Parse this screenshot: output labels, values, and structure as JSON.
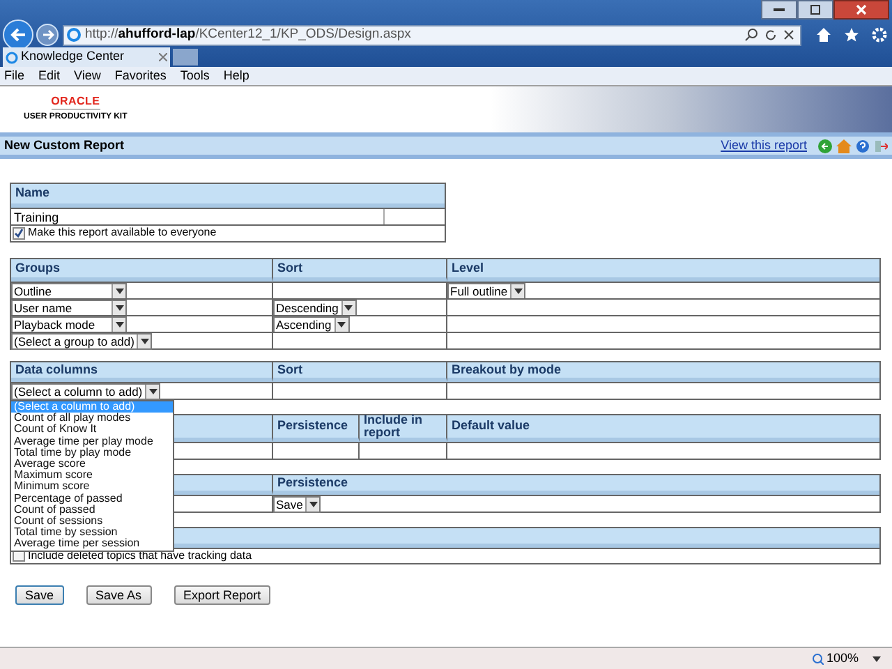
{
  "browser": {
    "url_host": "http://",
    "url_bold": "ahufford-lap",
    "url_path": "/KCenter12_1/KP_ODS/Design.aspx",
    "tab": "Knowledge Center",
    "menu": [
      "File",
      "Edit",
      "View",
      "Favorites",
      "Tools",
      "Help"
    ],
    "zoom": "100%"
  },
  "header": {
    "logo": "ORACLE",
    "product": "USER PRODUCTIVITY KIT"
  },
  "title_bar": {
    "title": "New Custom Report",
    "link": "View this report"
  },
  "name_section": {
    "heading": "Name",
    "value": "Training",
    "share_label": "Make this report available to everyone",
    "share_checked": true
  },
  "groups": {
    "columns": [
      "Groups",
      "Sort",
      "Level"
    ],
    "rows": [
      {
        "group": "Outline",
        "level": "Full outline"
      },
      {
        "group": "User name",
        "sort": "Descending"
      },
      {
        "group": "Playback mode",
        "sort": "Ascending"
      },
      {
        "group": "(Select a group to add)"
      }
    ]
  },
  "data_columns": {
    "columns": [
      "Data columns",
      "Sort",
      "Breakout by mode"
    ],
    "select": "(Select a column to add)",
    "options": [
      {
        "label": "(Select a column to add)",
        "selected": true
      },
      {
        "label": "Count of all play modes",
        "selected": false
      },
      {
        "label": "Count of Know It",
        "selected": false
      },
      {
        "label": "Average time per play mode",
        "selected": false
      },
      {
        "label": "Total time by play mode",
        "selected": false
      },
      {
        "label": "Average score",
        "selected": false
      },
      {
        "label": "Maximum score",
        "selected": false
      },
      {
        "label": "Minimum score",
        "selected": false
      },
      {
        "label": "Percentage of passed",
        "selected": false
      },
      {
        "label": "Count of passed",
        "selected": false
      },
      {
        "label": "Count of sessions",
        "selected": false
      },
      {
        "label": "Total time by session",
        "selected": false
      },
      {
        "label": "Average time per session",
        "selected": false
      }
    ]
  },
  "filters": {
    "columns": [
      "Persistence",
      "Include in report",
      "Default value"
    ]
  },
  "options_section": {
    "columns": [
      "Persistence"
    ],
    "persistence": "Save"
  },
  "other_section": {
    "deleted_label": "Include deleted topics that have tracking data",
    "deleted_checked": false
  },
  "buttons": [
    "Save",
    "Save As",
    "Export Report"
  ]
}
